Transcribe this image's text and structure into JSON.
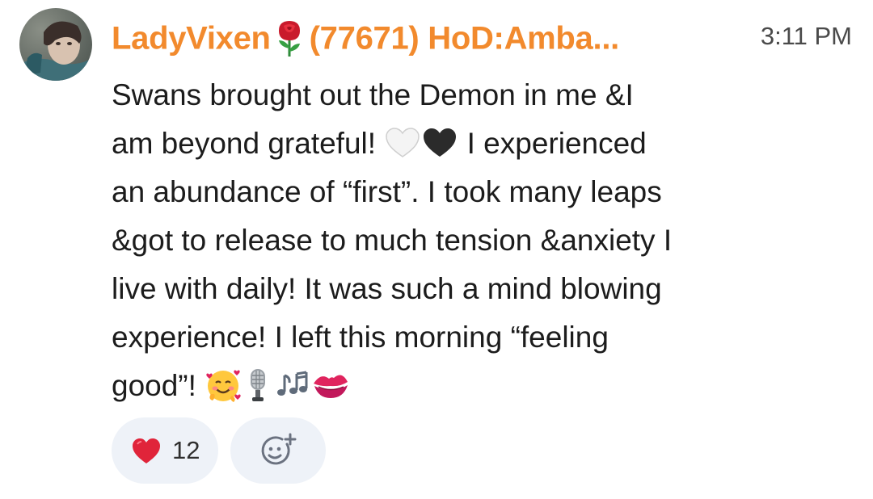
{
  "sender": {
    "name": "LadyVixen",
    "name_suffix": "(77671) HoD:Amba...",
    "name_color": "#f28a2d",
    "avatar": "user-avatar-photo",
    "badge_icon": "rose-emoji"
  },
  "timestamp": "3:11 PM",
  "message": {
    "lines": [
      {
        "segments": [
          "Swans brought out the Demon in me &I"
        ]
      },
      {
        "segments": [
          "am beyond grateful! ",
          " I experienced"
        ],
        "emojis": [
          "white-heart-emoji",
          "black-heart-emoji"
        ]
      },
      {
        "segments": [
          "an abundance of “first”. I took many leaps"
        ]
      },
      {
        "segments": [
          "&got to release to much tension &anxiety I"
        ]
      },
      {
        "segments": [
          "live with daily! It was such a mind blowing"
        ]
      },
      {
        "segments": [
          "experience! I left this morning “feeling"
        ]
      },
      {
        "segments": [
          "good”! "
        ],
        "emojis": [
          "smiling-face-with-hearts-emoji",
          "microphone-emoji",
          "musical-notes-emoji",
          "kiss-mark-emoji"
        ]
      }
    ]
  },
  "reactions": [
    {
      "icon": "red-heart-emoji",
      "count": "12"
    }
  ],
  "add_reaction_icon": "add-reaction-icon",
  "colors": {
    "accent": "#f28a2d",
    "chip_background": "#eef2f8",
    "text": "#1c1c1c",
    "timestamp": "#4a4a4a"
  }
}
